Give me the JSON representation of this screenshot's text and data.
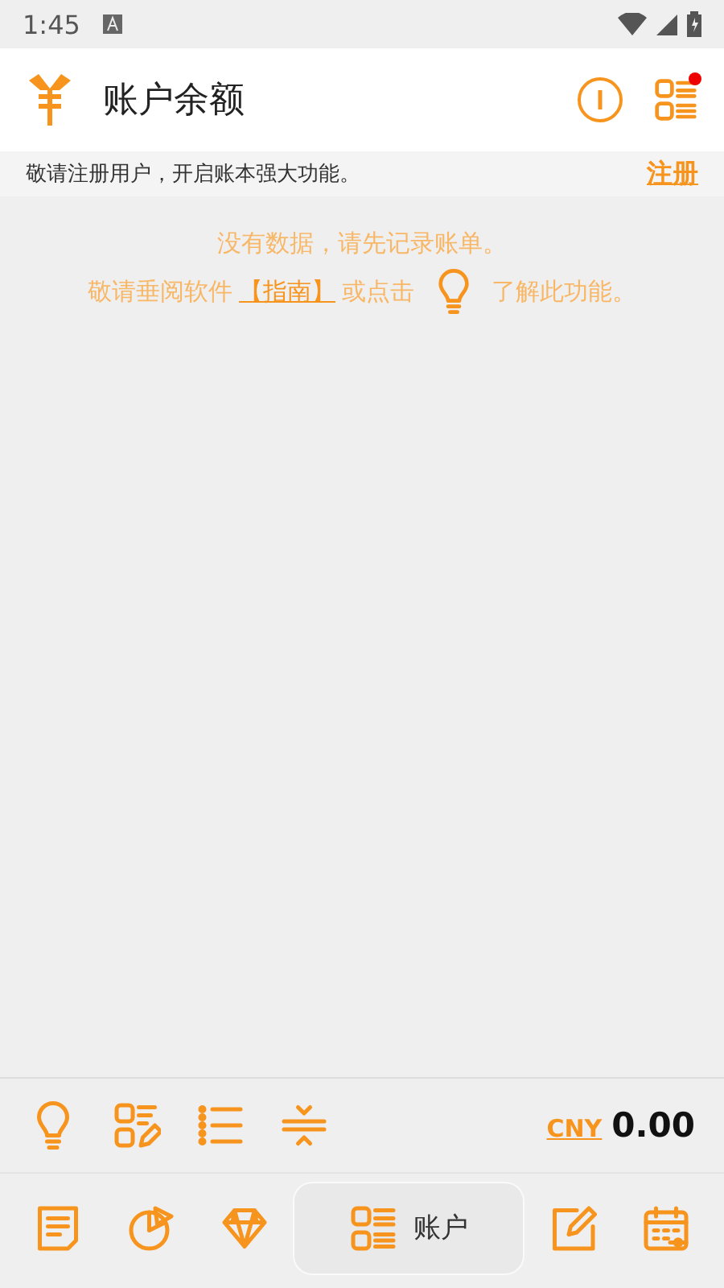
{
  "status_bar": {
    "time": "1:45"
  },
  "app_bar": {
    "title": "账户余额",
    "notification_dot": true
  },
  "notice": {
    "text": "敬请注册用户，开启账本强大功能。",
    "action": "注册"
  },
  "empty_state": {
    "message": "没有数据，请先记录账单。",
    "hint_before": "敬请垂阅软件",
    "guide_link": "【指南】",
    "hint_middle": "或点击",
    "hint_after": "了解此功能。"
  },
  "toolbar": {
    "tools": [
      {
        "kind": "bulb"
      },
      {
        "kind": "edit-list"
      },
      {
        "kind": "list"
      },
      {
        "kind": "collapse"
      }
    ],
    "currency": "CNY",
    "balance": "0.00"
  },
  "bottom_nav": [
    {
      "kind": "notes",
      "selected": false
    },
    {
      "kind": "chart",
      "selected": false
    },
    {
      "kind": "diamond",
      "selected": false
    },
    {
      "kind": "grid",
      "selected": true,
      "label": "账户"
    },
    {
      "kind": "edit",
      "selected": false
    },
    {
      "kind": "calendar",
      "selected": false
    }
  ]
}
